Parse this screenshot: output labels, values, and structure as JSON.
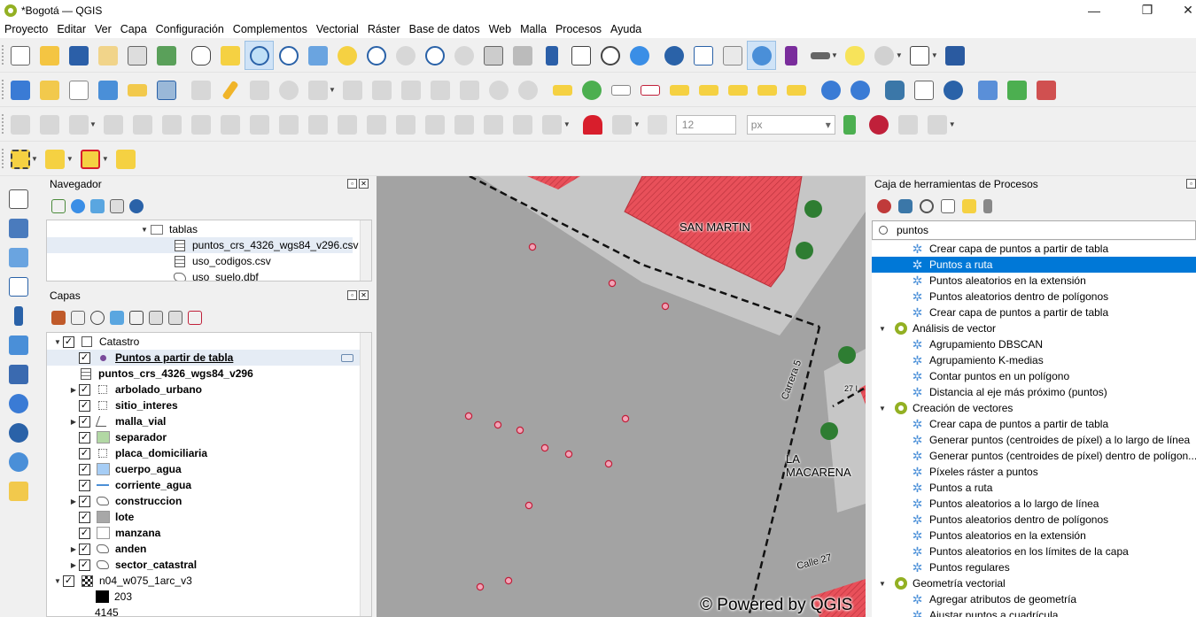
{
  "window": {
    "title": "*Bogotá — QGIS",
    "minimize": "—",
    "restore": "❐",
    "close": "✕"
  },
  "menu": [
    "Proyecto",
    "Editar",
    "Ver",
    "Capa",
    "Configuración",
    "Complementos",
    "Vectorial",
    "Ráster",
    "Base de datos",
    "Web",
    "Malla",
    "Procesos",
    "Ayuda"
  ],
  "toolbar3": {
    "size_value": "12",
    "unit_value": "px"
  },
  "browser": {
    "title": "Navegador",
    "items": [
      {
        "label": "tablas",
        "icon": "folder-icon"
      },
      {
        "label": "puntos_crs_4326_wgs84_v296.csv",
        "icon": "table-icon"
      },
      {
        "label": "uso_codigos.csv",
        "icon": "table-icon"
      },
      {
        "label": "uso_suelo.dbf",
        "icon": "polygon-layer-icon"
      }
    ]
  },
  "layers": {
    "title": "Capas",
    "items": [
      {
        "label": "Catastro",
        "type": "group"
      },
      {
        "label": "Puntos a partir de tabla",
        "type": "point"
      },
      {
        "label": "puntos_crs_4326_wgs84_v296",
        "type": "table"
      },
      {
        "label": "arbolado_urbano",
        "type": "point"
      },
      {
        "label": "sitio_interes",
        "type": "point"
      },
      {
        "label": "malla_vial",
        "type": "line"
      },
      {
        "label": "separador",
        "type": "fill",
        "color": "#b2d8a4"
      },
      {
        "label": "placa_domiciliaria",
        "type": "point"
      },
      {
        "label": "cuerpo_agua",
        "type": "fill",
        "color": "#a6cdf5"
      },
      {
        "label": "corriente_agua",
        "type": "line",
        "color": "#4b8fd6"
      },
      {
        "label": "construccion",
        "type": "polygon"
      },
      {
        "label": "lote",
        "type": "fill",
        "color": "#a8a8a8"
      },
      {
        "label": "manzana",
        "type": "fill",
        "color": "#ffffff"
      },
      {
        "label": "anden",
        "type": "polygon"
      },
      {
        "label": "sector_catastral",
        "type": "polygon"
      },
      {
        "label": "n04_w075_1arc_v3",
        "type": "raster"
      },
      {
        "label": "203",
        "type": "swatch",
        "color": "#000000"
      },
      {
        "label": "4145",
        "type": "text"
      }
    ]
  },
  "map": {
    "labels": [
      "SAN MARTIN",
      "LA MACARENA",
      "Carrera 5",
      "Calle 27",
      "27 I"
    ],
    "watermark": "© Powered by QGIS"
  },
  "processing": {
    "title": "Caja de herramientas de Procesos",
    "search": "puntos",
    "items": [
      {
        "label": "Crear capa de puntos a partir de tabla",
        "kind": "alg",
        "indent": 1
      },
      {
        "label": "Puntos a ruta",
        "kind": "alg",
        "indent": 1,
        "selected": true
      },
      {
        "label": "Puntos aleatorios en la extensión",
        "kind": "alg",
        "indent": 1
      },
      {
        "label": "Puntos aleatorios dentro de polígonos",
        "kind": "alg",
        "indent": 1
      },
      {
        "label": "Crear capa de puntos a partir de tabla",
        "kind": "alg",
        "indent": 1
      },
      {
        "label": "Análisis de vector",
        "kind": "group",
        "indent": 0
      },
      {
        "label": "Agrupamiento DBSCAN",
        "kind": "alg",
        "indent": 1
      },
      {
        "label": "Agrupamiento K-medias",
        "kind": "alg",
        "indent": 1
      },
      {
        "label": "Contar puntos en un polígono",
        "kind": "alg",
        "indent": 1
      },
      {
        "label": "Distancia al eje más próximo (puntos)",
        "kind": "alg",
        "indent": 1
      },
      {
        "label": "Creación de vectores",
        "kind": "group",
        "indent": 0
      },
      {
        "label": "Crear capa de puntos a partir de tabla",
        "kind": "alg",
        "indent": 1
      },
      {
        "label": "Generar puntos (centroides de píxel) a lo largo de línea",
        "kind": "alg",
        "indent": 1
      },
      {
        "label": "Generar puntos (centroides de píxel) dentro de polígon...",
        "kind": "alg",
        "indent": 1
      },
      {
        "label": "Píxeles ráster a puntos",
        "kind": "alg",
        "indent": 1
      },
      {
        "label": "Puntos a ruta",
        "kind": "alg",
        "indent": 1
      },
      {
        "label": "Puntos aleatorios a lo largo de línea",
        "kind": "alg",
        "indent": 1
      },
      {
        "label": "Puntos aleatorios dentro de polígonos",
        "kind": "alg",
        "indent": 1
      },
      {
        "label": "Puntos aleatorios en la extensión",
        "kind": "alg",
        "indent": 1
      },
      {
        "label": "Puntos aleatorios en los límites de la capa",
        "kind": "alg",
        "indent": 1
      },
      {
        "label": "Puntos regulares",
        "kind": "alg",
        "indent": 1
      },
      {
        "label": "Geometría vectorial",
        "kind": "group",
        "indent": 0
      },
      {
        "label": "Agregar atributos de geometría",
        "kind": "alg",
        "indent": 1
      },
      {
        "label": "Ajustar puntos a cuadrícula",
        "kind": "alg",
        "indent": 1
      }
    ]
  },
  "colors": {
    "accent": "#0078d7",
    "building": "#e8505a",
    "point_fill": "#f2a5b8",
    "point_stroke": "#c0203a",
    "tree": "#2e7d32"
  }
}
